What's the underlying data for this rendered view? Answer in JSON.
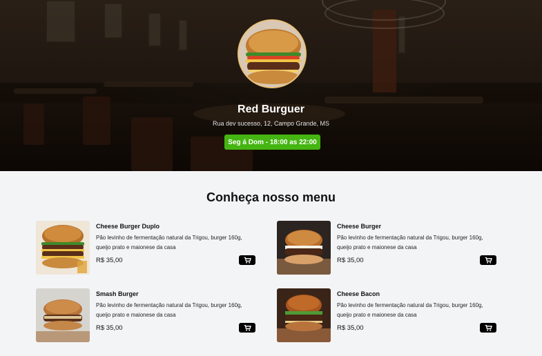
{
  "header": {
    "name": "Red Burguer",
    "address": "Rua dev sucesso, 12, Campo Grande, MS",
    "hours": "Seg á Dom - 18:00 as 22:00",
    "accent_color": "#45b512"
  },
  "menu": {
    "title": "Conheça nosso menu",
    "items": [
      {
        "name": "Cheese Burger Duplo",
        "description": "Pão levinho de fermentação natural da Trigou, burger 160g, queijo prato e maionese da casa",
        "price": "R$ 35,00",
        "icon": "cart-icon"
      },
      {
        "name": "Cheese Burger",
        "description": "Pão levinho de fermentação natural da Trigou, burger 160g, queijo prato e maionese da casa",
        "price": "R$ 35,00",
        "icon": "cart-icon"
      },
      {
        "name": "Smash Burger",
        "description": "Pão levinho de fermentação natural da Trigou, burger 160g, queijo prato e maionese da casa",
        "price": "R$ 35,00",
        "icon": "cart-icon"
      },
      {
        "name": "Cheese Bacon",
        "description": "Pão levinho de fermentação natural da Trigou, burger 160g, queijo prato e maionese da casa",
        "price": "R$ 35,00",
        "icon": "cart-icon"
      }
    ]
  }
}
